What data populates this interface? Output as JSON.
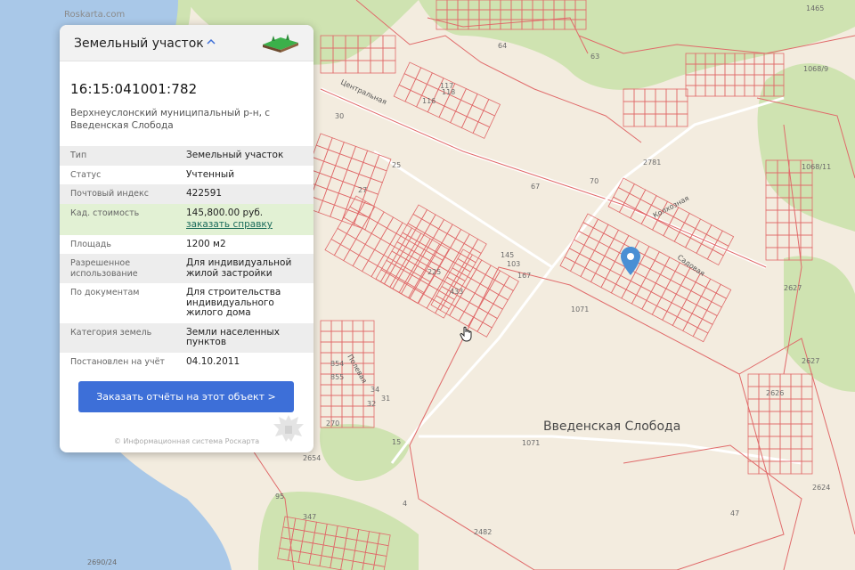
{
  "map": {
    "watermark": "Roskarta.com",
    "locality_name": "Введенская Слобода",
    "labels": [
      {
        "text": "64"
      },
      {
        "text": "63"
      },
      {
        "text": "1465"
      },
      {
        "text": "1068/9"
      },
      {
        "text": "30"
      },
      {
        "text": "27"
      },
      {
        "text": "25"
      },
      {
        "text": "2781"
      },
      {
        "text": "70"
      },
      {
        "text": "1068/11"
      },
      {
        "text": "67"
      },
      {
        "text": "2627"
      },
      {
        "text": "2627"
      },
      {
        "text": "2626"
      },
      {
        "text": "2624"
      },
      {
        "text": "1071"
      },
      {
        "text": "1071"
      },
      {
        "text": "433"
      },
      {
        "text": "225"
      },
      {
        "text": "15"
      },
      {
        "text": "4"
      },
      {
        "text": "47"
      },
      {
        "text": "2482"
      },
      {
        "text": "2690/24"
      },
      {
        "text": "270"
      },
      {
        "text": "347"
      },
      {
        "text": "95"
      },
      {
        "text": "854"
      },
      {
        "text": "855"
      },
      {
        "text": "34"
      },
      {
        "text": "32"
      },
      {
        "text": "31"
      },
      {
        "text": "2654"
      },
      {
        "text": "118"
      },
      {
        "text": "116"
      },
      {
        "text": "117"
      },
      {
        "text": "103"
      },
      {
        "text": "145"
      },
      {
        "text": "167"
      }
    ],
    "streets": [
      "Центральная",
      "Колхозная",
      "Садовая",
      "Полевая"
    ],
    "colors": {
      "background": "#f3ecdf",
      "water": "#a9c8e8",
      "green": "#cfe3b1",
      "parcel": "#e06a6a",
      "pin": "#4a8fd4"
    }
  },
  "card": {
    "header_title": "Земельный участок",
    "header_icon": "land-plot-icon",
    "chevron_icon": "chevron-up-icon",
    "cadastral_number": "16:15:041001:782",
    "address": "Верхнеуслонский муниципальный р-н, с Введенская Слобода",
    "rows": [
      {
        "key": "Тип",
        "value": "Земельный участок"
      },
      {
        "key": "Статус",
        "value": "Учтенный"
      },
      {
        "key": "Почтовый индекс",
        "value": "422591"
      },
      {
        "key": "Кад. стоимость",
        "value": "145,800.00 руб.",
        "link": "заказать справку"
      },
      {
        "key": "Площадь",
        "value": "1200 м2"
      },
      {
        "key": "Разрешенное использование",
        "value": "Для индивидуальной жилой застройки"
      },
      {
        "key": "По документам",
        "value": "Для строительства индивидуального жилого дома"
      },
      {
        "key": "Категория земель",
        "value": "Земли населенных пунктов"
      },
      {
        "key": "Постановлен на учёт",
        "value": "04.10.2011"
      }
    ],
    "order_button": "Заказать отчёты на этот объект >",
    "footer": "© Информационная система Роскарта",
    "crest_icon": "coat-of-arms-icon"
  }
}
